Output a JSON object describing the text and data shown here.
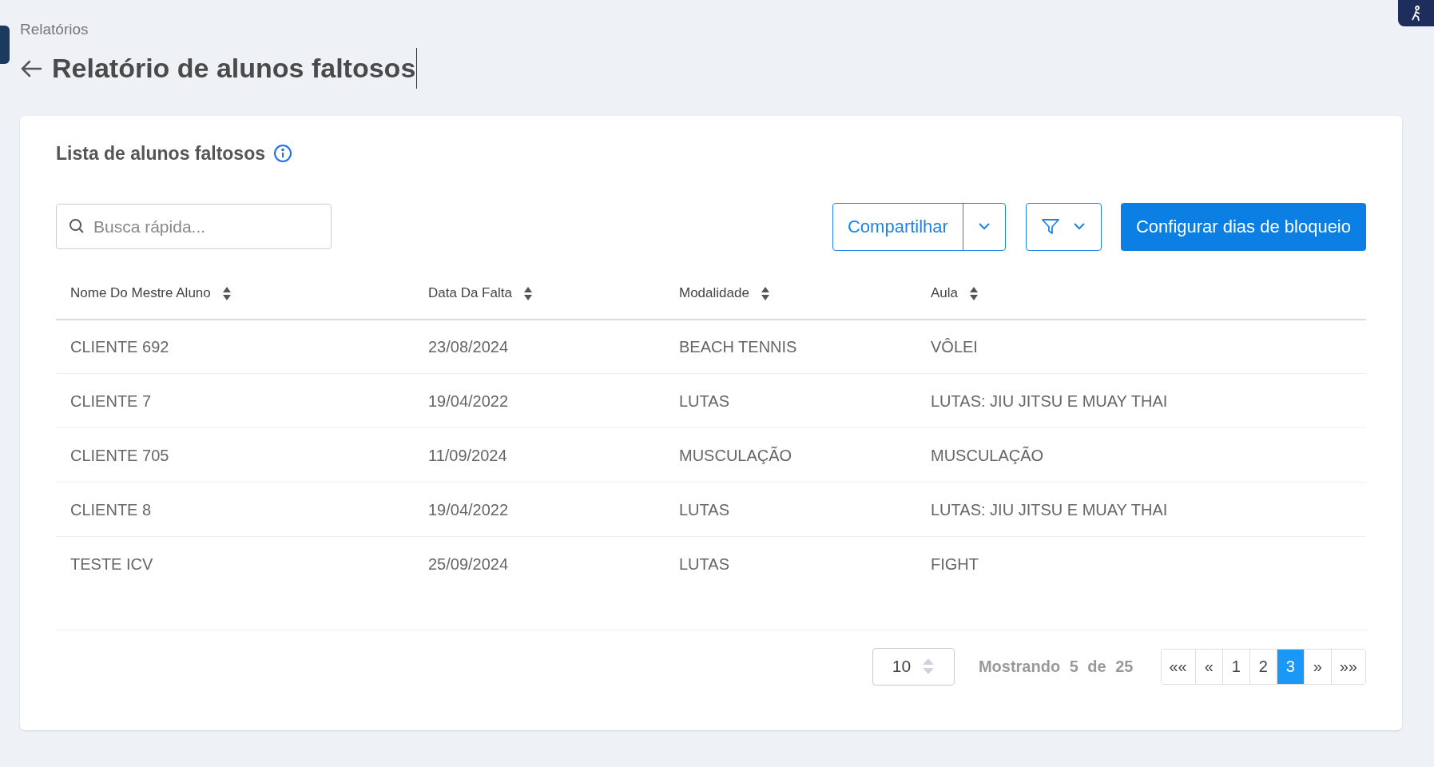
{
  "breadcrumb": "Relatórios",
  "title": "Relatório de alunos faltosos",
  "card": {
    "title": "Lista de alunos faltosos",
    "search": {
      "placeholder": "Busca rápida..."
    },
    "share_button": "Compartilhar",
    "primary_button": "Configurar dias de bloqueio",
    "table": {
      "columns": [
        "Nome Do Mestre Aluno",
        "Data Da Falta",
        "Modalidade",
        "Aula"
      ],
      "rows": [
        [
          "CLIENTE 692",
          "23/08/2024",
          "BEACH TENNIS",
          "VÔLEI"
        ],
        [
          "CLIENTE 7",
          "19/04/2022",
          "LUTAS",
          "LUTAS: JIU JITSU E MUAY THAI"
        ],
        [
          "CLIENTE 705",
          "11/09/2024",
          "MUSCULAÇÃO",
          "MUSCULAÇÃO"
        ],
        [
          "CLIENTE 8",
          "19/04/2022",
          "LUTAS",
          "LUTAS: JIU JITSU E MUAY THAI"
        ],
        [
          "TESTE ICV",
          "25/09/2024",
          "LUTAS",
          "FIGHT"
        ]
      ]
    },
    "page_size": "10",
    "summary": "Mostrando 5 de 25",
    "pagination": [
      {
        "label": "««",
        "selected": false
      },
      {
        "label": "«",
        "selected": false
      },
      {
        "label": "1",
        "selected": false
      },
      {
        "label": "2",
        "selected": false
      },
      {
        "label": "3",
        "selected": true
      },
      {
        "label": "»",
        "selected": false
      },
      {
        "label": "»»",
        "selected": false
      }
    ]
  }
}
